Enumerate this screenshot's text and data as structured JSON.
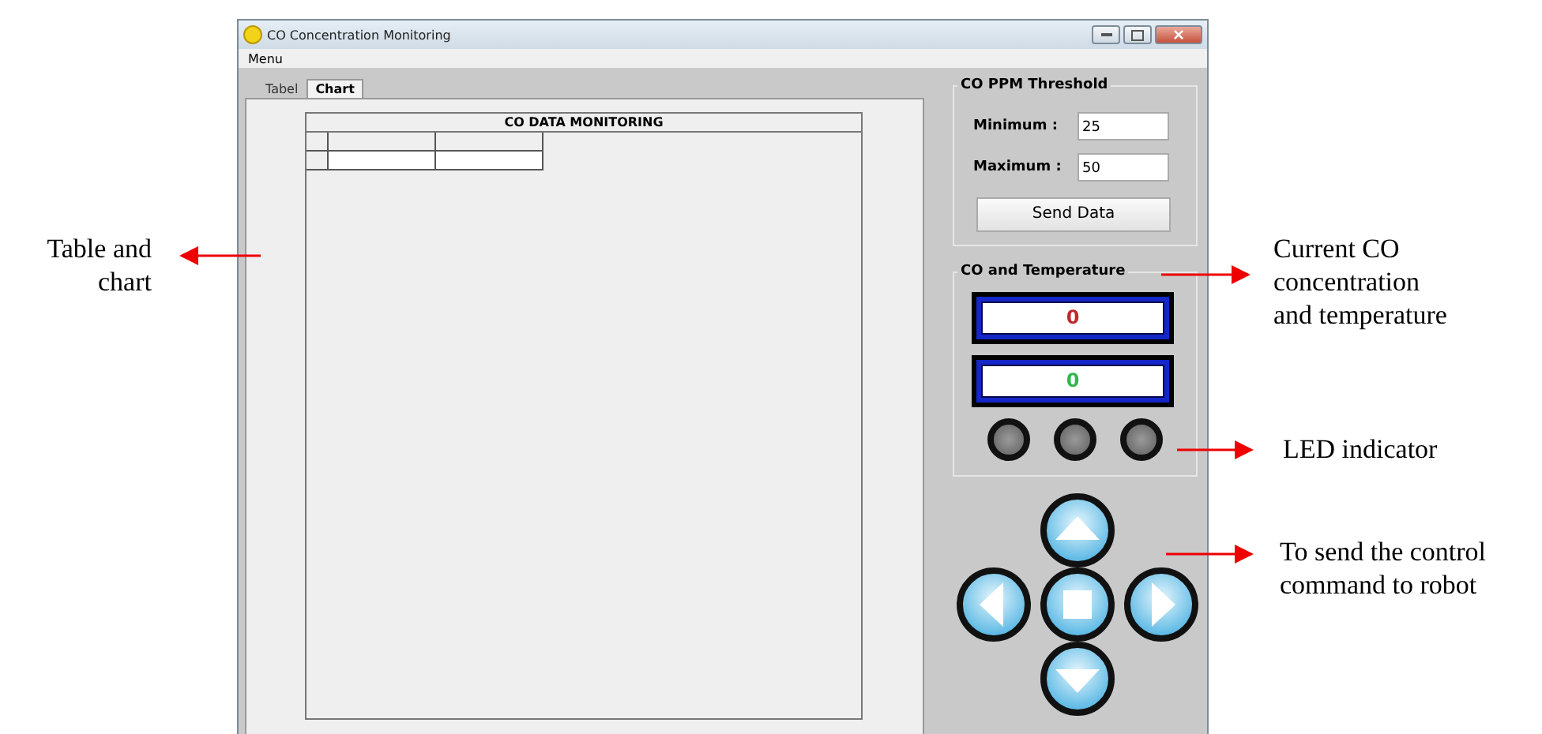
{
  "annotations": [
    {
      "lines": [
        "Table and",
        "chart"
      ]
    },
    {
      "lines": [
        "Current CO",
        "concentration",
        "and temperature"
      ]
    },
    {
      "lines": [
        "LED indicator"
      ]
    },
    {
      "lines": [
        "To send the control",
        "command to robot"
      ]
    }
  ],
  "window": {
    "title": "CO Concentration Monitoring",
    "menu": "Menu"
  },
  "tabs": [
    {
      "label": "Tabel",
      "selected": false
    },
    {
      "label": "Chart",
      "selected": true
    }
  ],
  "table": {
    "title": "CO DATA MONITORING"
  },
  "threshold": {
    "title": "CO PPM Threshold",
    "fields": [
      {
        "label": "Minimum :",
        "value": "25"
      },
      {
        "label": "Maximum :",
        "value": "50"
      }
    ],
    "button": "Send Data"
  },
  "readings": {
    "title": "CO and Temperature",
    "displays": [
      {
        "value": "0",
        "color": "#c0282a"
      },
      {
        "value": "0",
        "color": "#2fb84a"
      }
    ],
    "leds": [
      {
        "on": false
      },
      {
        "on": false
      },
      {
        "on": false
      }
    ]
  },
  "controls": [
    {
      "kind": "up"
    },
    {
      "kind": "left"
    },
    {
      "kind": "stop"
    },
    {
      "kind": "right"
    },
    {
      "kind": "down"
    }
  ]
}
